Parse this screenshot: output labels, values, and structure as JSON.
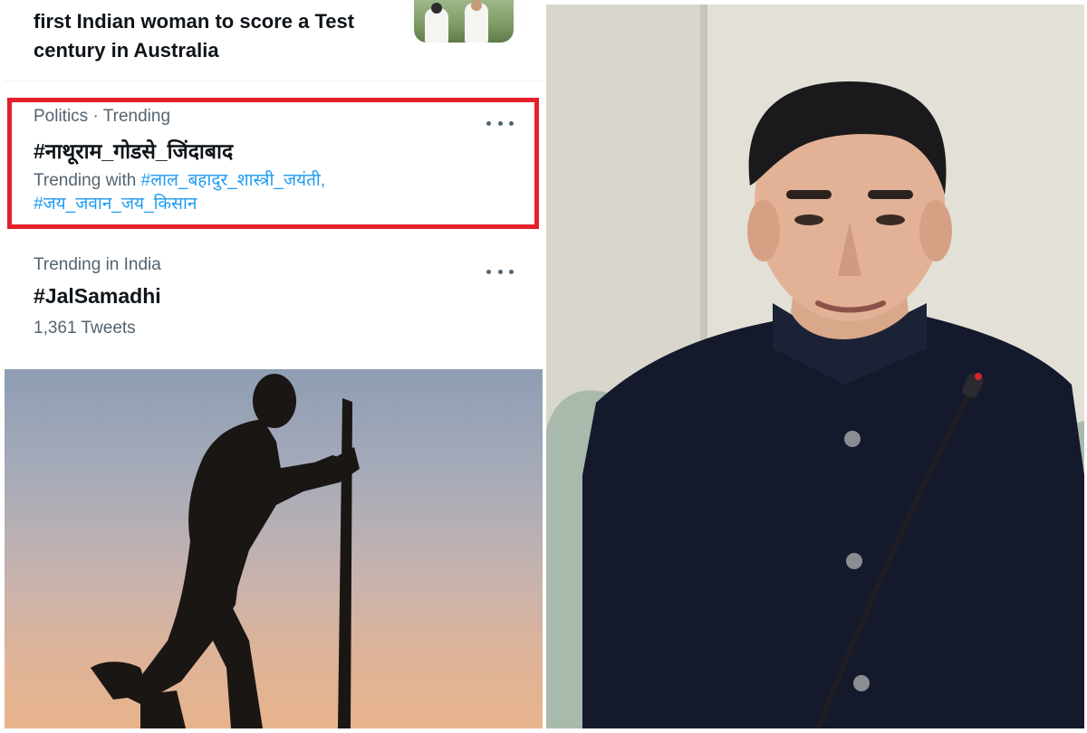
{
  "trends": {
    "top_story": {
      "headline": "first Indian woman to score a Test century in Australia"
    },
    "items": [
      {
        "category": "Politics · Trending",
        "hashtag": "#नाथूराम_गोडसे_जिंदाबाद",
        "trending_with_label": "Trending with",
        "related": [
          "#लाल_बहादुर_शास्त्री_जयंती,",
          "#जय_जवान_जय_किसान"
        ],
        "highlighted": true
      },
      {
        "category": "Trending in India",
        "hashtag": "#JalSamadhi",
        "count": "1,361 Tweets"
      }
    ]
  },
  "icons": {
    "more": "more-horizontal-icon"
  },
  "colors": {
    "highlight_border": "#e4202a",
    "link": "#1d9bf0",
    "secondary_text": "#536471",
    "primary_text": "#0f1419"
  }
}
